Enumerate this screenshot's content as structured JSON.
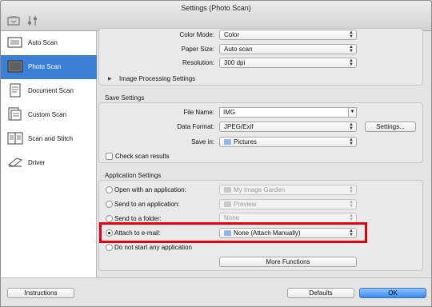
{
  "window": {
    "title": "Settings (Photo Scan)"
  },
  "toolbar": {
    "icons": [
      "scan-from-operation-panel-icon",
      "general-settings-icon"
    ]
  },
  "sidebar": {
    "items": [
      {
        "label": "Auto Scan",
        "icon": "auto-scan-icon",
        "selected": false
      },
      {
        "label": "Photo Scan",
        "icon": "photo-scan-icon",
        "selected": true
      },
      {
        "label": "Document Scan",
        "icon": "document-scan-icon",
        "selected": false
      },
      {
        "label": "Custom Scan",
        "icon": "custom-scan-icon",
        "selected": false
      },
      {
        "label": "Scan and Stitch",
        "icon": "scan-and-stitch-icon",
        "selected": false
      },
      {
        "label": "Driver",
        "icon": "driver-icon",
        "selected": false
      }
    ]
  },
  "scan_options": {
    "color_mode": {
      "label": "Color Mode:",
      "value": "Color"
    },
    "paper_size": {
      "label": "Paper Size:",
      "value": "Auto scan"
    },
    "resolution": {
      "label": "Resolution:",
      "value": "300 dpi"
    },
    "image_processing": {
      "label": "Image Processing Settings"
    }
  },
  "save_settings": {
    "title": "Save Settings",
    "file_name": {
      "label": "File Name:",
      "value": "IMG"
    },
    "data_format": {
      "label": "Data Format:",
      "value": "JPEG/Exif"
    },
    "settings_button": "Settings...",
    "save_in": {
      "label": "Save in:",
      "value": "Pictures"
    },
    "check_scan_results": {
      "label": "Check scan results",
      "checked": false
    }
  },
  "application_settings": {
    "title": "Application Settings",
    "options": [
      {
        "label": "Open with an application:",
        "value": "My Image Garden",
        "selected": false
      },
      {
        "label": "Send to an application:",
        "value": "Preview",
        "selected": false
      },
      {
        "label": "Send to a folder:",
        "value": "None",
        "selected": false
      },
      {
        "label": "Attach to e-mail:",
        "value": "None (Attach Manually)",
        "selected": true
      },
      {
        "label": "Do not start any application",
        "value": "",
        "selected": false
      }
    ],
    "more_functions": "More Functions"
  },
  "footer": {
    "instructions": "Instructions",
    "defaults": "Defaults",
    "ok": "OK"
  },
  "colors": {
    "accent": "#3b7fd7",
    "highlight_box": "#e3000f"
  }
}
